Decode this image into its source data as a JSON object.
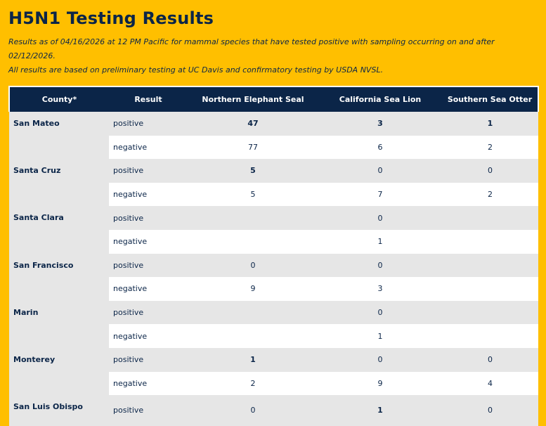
{
  "page": {
    "title": "H5N1 Testing Results",
    "note_line1": "Results as of 04/16/2026 at 12 PM Pacific for mammal species that have tested positive with sampling occurring on and after 02/12/2026.",
    "note_line2": "All results are based on preliminary testing at UC Davis and confirmatory testing by USDA NVSL."
  },
  "table": {
    "headers": [
      "County*",
      "Result",
      "Northern Elephant Seal",
      "California Sea Lion",
      "Southern Sea Otter"
    ],
    "rows": [
      {
        "county": "San Mateo",
        "positive": [
          "47",
          "3",
          "1"
        ],
        "negative": [
          "77",
          "6",
          "2"
        ]
      },
      {
        "county": "Santa Cruz",
        "positive": [
          "5",
          "0",
          "0"
        ],
        "negative": [
          "5",
          "7",
          "2"
        ]
      },
      {
        "county": "Santa Clara",
        "positive": [
          "",
          "0",
          ""
        ],
        "negative": [
          "",
          "1",
          ""
        ]
      },
      {
        "county": "San Francisco",
        "positive": [
          "0",
          "0",
          ""
        ],
        "negative": [
          "9",
          "3",
          ""
        ]
      },
      {
        "county": "Marin",
        "positive": [
          "",
          "0",
          ""
        ],
        "negative": [
          "",
          "1",
          ""
        ]
      },
      {
        "county": "Monterey",
        "positive": [
          "1",
          "0",
          "0"
        ],
        "negative": [
          "2",
          "9",
          "4"
        ]
      },
      {
        "county": "San Luis Obispo",
        "positive": [
          "0",
          "1",
          "0"
        ],
        "negative": []
      }
    ],
    "positive_label": "positive",
    "negative_label": "negative"
  }
}
